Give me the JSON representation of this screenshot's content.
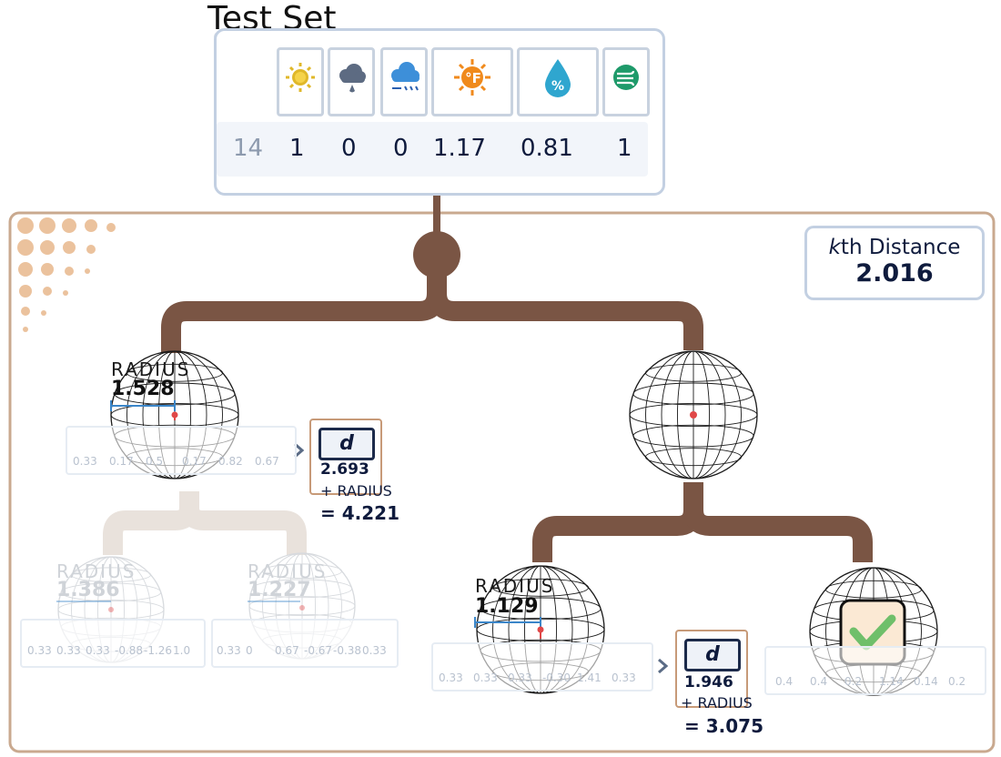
{
  "title": "Test Set",
  "test_set": {
    "icons": [
      "sun-icon",
      "rain-cloud-icon",
      "wind-rain-icon",
      "hot-sun-icon",
      "humidity-drop-icon",
      "wind-icon"
    ],
    "index": "14",
    "values": [
      "1",
      "0",
      "0",
      "1.17",
      "0.81",
      "1"
    ]
  },
  "kth": {
    "label_k": "k",
    "label_rest": "th Distance",
    "value": "2.016"
  },
  "node_root_left": {
    "radius_label": "RADIUS",
    "radius_value": "1.528",
    "values": [
      "0.33",
      "0.17",
      "0.5",
      "0.17",
      "0.82",
      "0.67"
    ]
  },
  "dist_left": {
    "d": "d",
    "value": "2.693",
    "plus": "+ RADIUS",
    "result": "= 4.221"
  },
  "node_ll": {
    "radius_label": "RADIUS",
    "radius_value": "1.386",
    "values": [
      "0.33",
      "0.33",
      "0.33",
      "-0.88",
      "-1.26",
      "1.0"
    ]
  },
  "node_lr": {
    "radius_label": "RADIUS",
    "radius_value": "1.227",
    "values": [
      "0.33",
      "0",
      "0.67",
      "-0.67",
      "-0.38",
      "0.33"
    ]
  },
  "node_rl": {
    "radius_label": "RADIUS",
    "radius_value": "1.129",
    "values": [
      "0.33",
      "0.33",
      "0.33",
      "-0.30",
      "1.41",
      "0.33"
    ]
  },
  "dist_right": {
    "d": "d",
    "value": "1.946",
    "plus": "+ RADIUS",
    "result": "= 3.075"
  },
  "node_rr": {
    "values": [
      "0.4",
      "0.4",
      "0.2",
      "1.14",
      "0.14",
      "0.2"
    ]
  },
  "colors": {
    "branch": "#7a5544",
    "faded_branch": "#e9e2dc",
    "frame": "#c9a98f",
    "center_dot": "#e04848",
    "radius_line": "#3b86c9",
    "check_fill": "#fbe9d4",
    "check_mark": "#6fbf6a"
  }
}
